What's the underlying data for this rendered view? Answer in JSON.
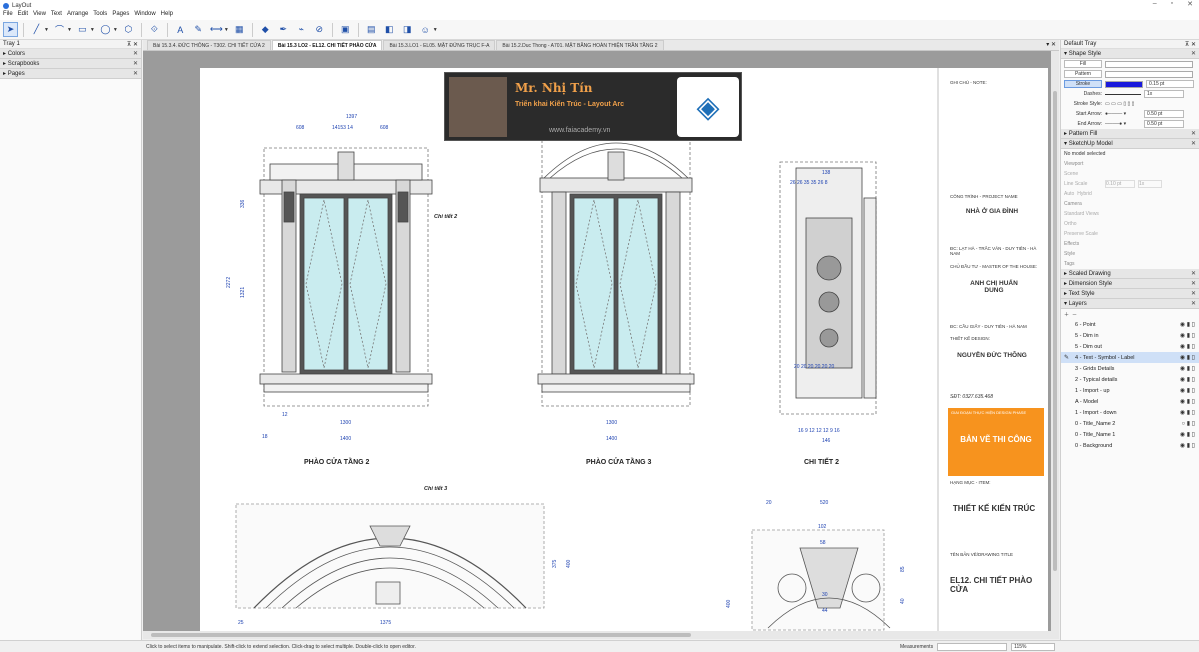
{
  "app": {
    "title": "LayOut"
  },
  "menu": [
    "File",
    "Edit",
    "View",
    "Text",
    "Arrange",
    "Tools",
    "Pages",
    "Window",
    "Help"
  ],
  "left_tray": {
    "title": "Tray 1",
    "panels": [
      "Colors",
      "Scrapbooks",
      "Pages"
    ]
  },
  "tabs": [
    {
      "label": "Bài 15.3.4. ĐỨC THÔNG - T302. CHI TIẾT CỬA 2"
    },
    {
      "label": "Bài 15.3 LO2 - EL12. CHI TIẾT PHÀO CỬA"
    },
    {
      "label": "Bài 15.3.LO1 - EL05. MẶT ĐỨNG TRỤC F-A"
    },
    {
      "label": "Bài 15.2.Duc Thong - A701. MẶT BẰNG HOÀN THIỆN TRẦN TẦNG 2"
    }
  ],
  "banner": {
    "name": "Mr. Nhị Tín",
    "subtitle": "Triển khai Kiến Trúc - Layout Arc",
    "url": "www.faiacademy.vn"
  },
  "drawing": {
    "label1": "PHÀO CỬA TẦNG 2",
    "label2": "PHÀO CỬA TẦNG 3",
    "label3": "CHI TIẾT 2",
    "callout2": "Chi tiết 2",
    "callout3": "Chi tiết 3",
    "dims": {
      "d1397": "1397",
      "d608a": "608",
      "d1415": "14153 14",
      "d608b": "608",
      "d2272": "2272",
      "d1321": "1321",
      "d336": "336",
      "d1300a": "1300",
      "d1400a": "1400",
      "d12": "12",
      "d18": "18",
      "d1300b": "1300",
      "d1400b": "1400",
      "d138": "138",
      "d26row": "26  26  35  35  26  8",
      "d146": "146",
      "d16row": "16  9  12  12  12  9  16",
      "d20row": "20  20  20  20  20  20",
      "d1375": "1375",
      "d375": "375",
      "d400a": "400",
      "d25": "25",
      "d520": "520",
      "d102": "102",
      "d58": "58",
      "d30": "30",
      "d44": "44",
      "d400b": "400",
      "d20": "20",
      "d85": "85",
      "d40": "40"
    }
  },
  "title_block": {
    "note_label": "GHI CHÚ - NOTE:",
    "project_label": "CÔNG TRÌNH - PROJECT NAME",
    "project_name": "NHÀ Ở GIA ĐÌNH",
    "address": "ĐC: LẠT HÀ - TRẮC VĂN - DUY TIÊN - HÀ NAM",
    "owner_label": "CHỦ ĐẦU TƯ - MASTER OF THE HOUSE:",
    "owner_name": "ANH CHỊ HUẤN DUNG",
    "owner_address": "ĐC: CẦU GIẤY - DUY TIÊN - HÀ NAM",
    "designer_label": "THIẾT KẾ DESIGN:",
    "designer_name": "NGUYỄN ĐỨC THÔNG",
    "phone": "SĐT: 0327.635.468",
    "phase_label": "GIAI ĐOẠN THỰC HIỆN DESIGN PHASE",
    "phase_name": "BẢN VẼ THI CÔNG",
    "item_label": "HẠNG MỤC - ITEM:",
    "item_name": "THIẾT KẾ KIẾN TRÚC",
    "sheet_label": "TÊN BẢN VẼ/DRAWING TITLE",
    "sheet_name": "EL12. CHI TIẾT PHÀO CỬA"
  },
  "right_tray": {
    "title": "Default Tray",
    "shape_style": {
      "header": "Shape Style",
      "fill": "Fill",
      "pattern": "Pattern",
      "stroke": "Stroke",
      "stroke_value": "0.15 pt",
      "dashes": "Dashes:",
      "dash_scale": "1x",
      "stroke_style": "Stroke Style:",
      "start_arrow": "Start Arrow:",
      "start_value": "0.50 pt",
      "end_arrow": "End Arrow:",
      "end_value": "0.50 pt",
      "stroke_color": "#1a1adc"
    },
    "pattern_fill": "Pattern Fill",
    "sketchup_model": {
      "header": "SketchUp Model",
      "status": "No model selected",
      "viewport": "Viewport",
      "scene": "Scene",
      "line_scale": "Line Scale",
      "line_scale_value": "0.10 pt",
      "line_scale_mult": "1x",
      "auto": "Auto",
      "hybrid": "Hybrid",
      "camera": "Camera",
      "standard_views": "Standard Views",
      "ortho": "Ortho",
      "preserve_scale": "Preserve Scale",
      "effects": "Effects",
      "style": "Style",
      "tags": "Tags"
    },
    "scaled_drawing": "Scaled Drawing",
    "dimension_style": "Dimension Style",
    "text_style": "Text Style",
    "layers": {
      "header": "Layers",
      "items": [
        "6 - Point",
        "5 - Dim in",
        "5 - Dim out",
        "4 - Text - Symbol - Label",
        "3 - Grids Details",
        "2 - Typical details",
        "1 - Import - up",
        "A - Model",
        "1 - Import - down",
        "0 - Title_Name 2",
        "0 - Title_Name 1",
        "0 - Background"
      ]
    }
  },
  "status": {
    "hint": "Click to select items to manipulate. Shift-click to extend selection. Click-drag to select multiple. Double-click to open editor.",
    "measurements": "Measurements",
    "zoom": "115%"
  },
  "colors": {
    "accent": "#1f4fa8",
    "phase": "#f7931e",
    "dim": "#1a3fb0",
    "selection": "#cfe0f7"
  }
}
